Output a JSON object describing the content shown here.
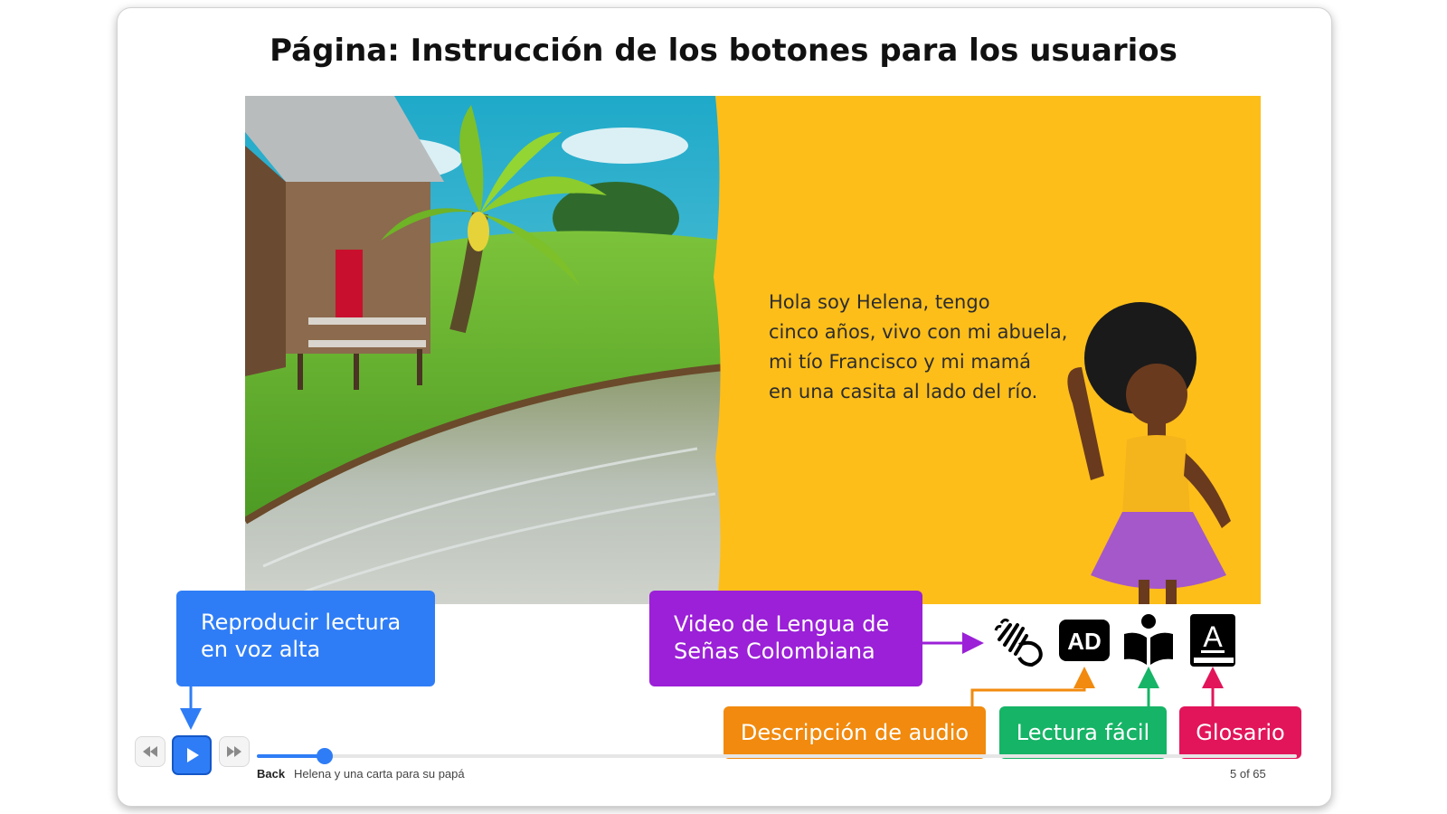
{
  "header": {
    "title": "Página: Instrucción de los botones para los usuarios"
  },
  "story": {
    "lines": [
      "Hola soy Helena, tengo",
      "cinco años, vivo con mi abuela,",
      "mi tío Francisco y mi mamá",
      "en una casita al lado del río."
    ]
  },
  "callouts": {
    "read_aloud": [
      "Reproducir lectura",
      "en voz alta"
    ],
    "sign_language": [
      "Video de Lengua de",
      "Señas Colombiana"
    ],
    "audio_description": "Descripción de audio",
    "easy_reading": "Lectura fácil",
    "glossary": "Glosario"
  },
  "toolbar": {
    "icons": [
      "sign-language-icon",
      "audio-description-icon",
      "easy-reading-icon",
      "glossary-icon"
    ],
    "ad_label": "AD",
    "glossary_letter": "A"
  },
  "player": {
    "back_label": "Back",
    "book_title": "Helena y una carta para su papá",
    "page_label": "5 of 65",
    "progress": 0.065
  },
  "colors": {
    "blue": "#2f7df6",
    "purple": "#9b20d7",
    "orange": "#f18a0e",
    "green": "#16b466",
    "magenta": "#e2155a",
    "yellow_page": "#fdbe1a"
  }
}
